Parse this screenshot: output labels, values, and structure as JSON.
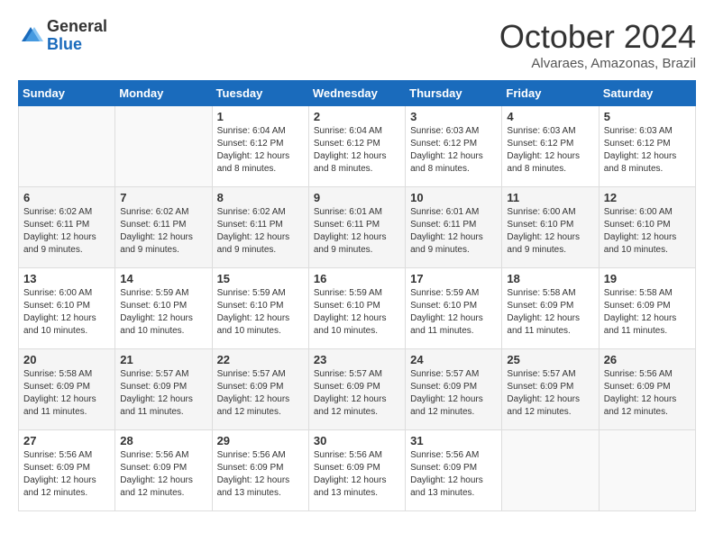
{
  "header": {
    "logo_general": "General",
    "logo_blue": "Blue",
    "month_title": "October 2024",
    "subtitle": "Alvaraes, Amazonas, Brazil"
  },
  "days_of_week": [
    "Sunday",
    "Monday",
    "Tuesday",
    "Wednesday",
    "Thursday",
    "Friday",
    "Saturday"
  ],
  "weeks": [
    [
      {
        "day": "",
        "info": ""
      },
      {
        "day": "",
        "info": ""
      },
      {
        "day": "1",
        "info": "Sunrise: 6:04 AM\nSunset: 6:12 PM\nDaylight: 12 hours and 8 minutes."
      },
      {
        "day": "2",
        "info": "Sunrise: 6:04 AM\nSunset: 6:12 PM\nDaylight: 12 hours and 8 minutes."
      },
      {
        "day": "3",
        "info": "Sunrise: 6:03 AM\nSunset: 6:12 PM\nDaylight: 12 hours and 8 minutes."
      },
      {
        "day": "4",
        "info": "Sunrise: 6:03 AM\nSunset: 6:12 PM\nDaylight: 12 hours and 8 minutes."
      },
      {
        "day": "5",
        "info": "Sunrise: 6:03 AM\nSunset: 6:12 PM\nDaylight: 12 hours and 8 minutes."
      }
    ],
    [
      {
        "day": "6",
        "info": "Sunrise: 6:02 AM\nSunset: 6:11 PM\nDaylight: 12 hours and 9 minutes."
      },
      {
        "day": "7",
        "info": "Sunrise: 6:02 AM\nSunset: 6:11 PM\nDaylight: 12 hours and 9 minutes."
      },
      {
        "day": "8",
        "info": "Sunrise: 6:02 AM\nSunset: 6:11 PM\nDaylight: 12 hours and 9 minutes."
      },
      {
        "day": "9",
        "info": "Sunrise: 6:01 AM\nSunset: 6:11 PM\nDaylight: 12 hours and 9 minutes."
      },
      {
        "day": "10",
        "info": "Sunrise: 6:01 AM\nSunset: 6:11 PM\nDaylight: 12 hours and 9 minutes."
      },
      {
        "day": "11",
        "info": "Sunrise: 6:00 AM\nSunset: 6:10 PM\nDaylight: 12 hours and 9 minutes."
      },
      {
        "day": "12",
        "info": "Sunrise: 6:00 AM\nSunset: 6:10 PM\nDaylight: 12 hours and 10 minutes."
      }
    ],
    [
      {
        "day": "13",
        "info": "Sunrise: 6:00 AM\nSunset: 6:10 PM\nDaylight: 12 hours and 10 minutes."
      },
      {
        "day": "14",
        "info": "Sunrise: 5:59 AM\nSunset: 6:10 PM\nDaylight: 12 hours and 10 minutes."
      },
      {
        "day": "15",
        "info": "Sunrise: 5:59 AM\nSunset: 6:10 PM\nDaylight: 12 hours and 10 minutes."
      },
      {
        "day": "16",
        "info": "Sunrise: 5:59 AM\nSunset: 6:10 PM\nDaylight: 12 hours and 10 minutes."
      },
      {
        "day": "17",
        "info": "Sunrise: 5:59 AM\nSunset: 6:10 PM\nDaylight: 12 hours and 11 minutes."
      },
      {
        "day": "18",
        "info": "Sunrise: 5:58 AM\nSunset: 6:09 PM\nDaylight: 12 hours and 11 minutes."
      },
      {
        "day": "19",
        "info": "Sunrise: 5:58 AM\nSunset: 6:09 PM\nDaylight: 12 hours and 11 minutes."
      }
    ],
    [
      {
        "day": "20",
        "info": "Sunrise: 5:58 AM\nSunset: 6:09 PM\nDaylight: 12 hours and 11 minutes."
      },
      {
        "day": "21",
        "info": "Sunrise: 5:57 AM\nSunset: 6:09 PM\nDaylight: 12 hours and 11 minutes."
      },
      {
        "day": "22",
        "info": "Sunrise: 5:57 AM\nSunset: 6:09 PM\nDaylight: 12 hours and 12 minutes."
      },
      {
        "day": "23",
        "info": "Sunrise: 5:57 AM\nSunset: 6:09 PM\nDaylight: 12 hours and 12 minutes."
      },
      {
        "day": "24",
        "info": "Sunrise: 5:57 AM\nSunset: 6:09 PM\nDaylight: 12 hours and 12 minutes."
      },
      {
        "day": "25",
        "info": "Sunrise: 5:57 AM\nSunset: 6:09 PM\nDaylight: 12 hours and 12 minutes."
      },
      {
        "day": "26",
        "info": "Sunrise: 5:56 AM\nSunset: 6:09 PM\nDaylight: 12 hours and 12 minutes."
      }
    ],
    [
      {
        "day": "27",
        "info": "Sunrise: 5:56 AM\nSunset: 6:09 PM\nDaylight: 12 hours and 12 minutes."
      },
      {
        "day": "28",
        "info": "Sunrise: 5:56 AM\nSunset: 6:09 PM\nDaylight: 12 hours and 12 minutes."
      },
      {
        "day": "29",
        "info": "Sunrise: 5:56 AM\nSunset: 6:09 PM\nDaylight: 12 hours and 13 minutes."
      },
      {
        "day": "30",
        "info": "Sunrise: 5:56 AM\nSunset: 6:09 PM\nDaylight: 12 hours and 13 minutes."
      },
      {
        "day": "31",
        "info": "Sunrise: 5:56 AM\nSunset: 6:09 PM\nDaylight: 12 hours and 13 minutes."
      },
      {
        "day": "",
        "info": ""
      },
      {
        "day": "",
        "info": ""
      }
    ]
  ]
}
